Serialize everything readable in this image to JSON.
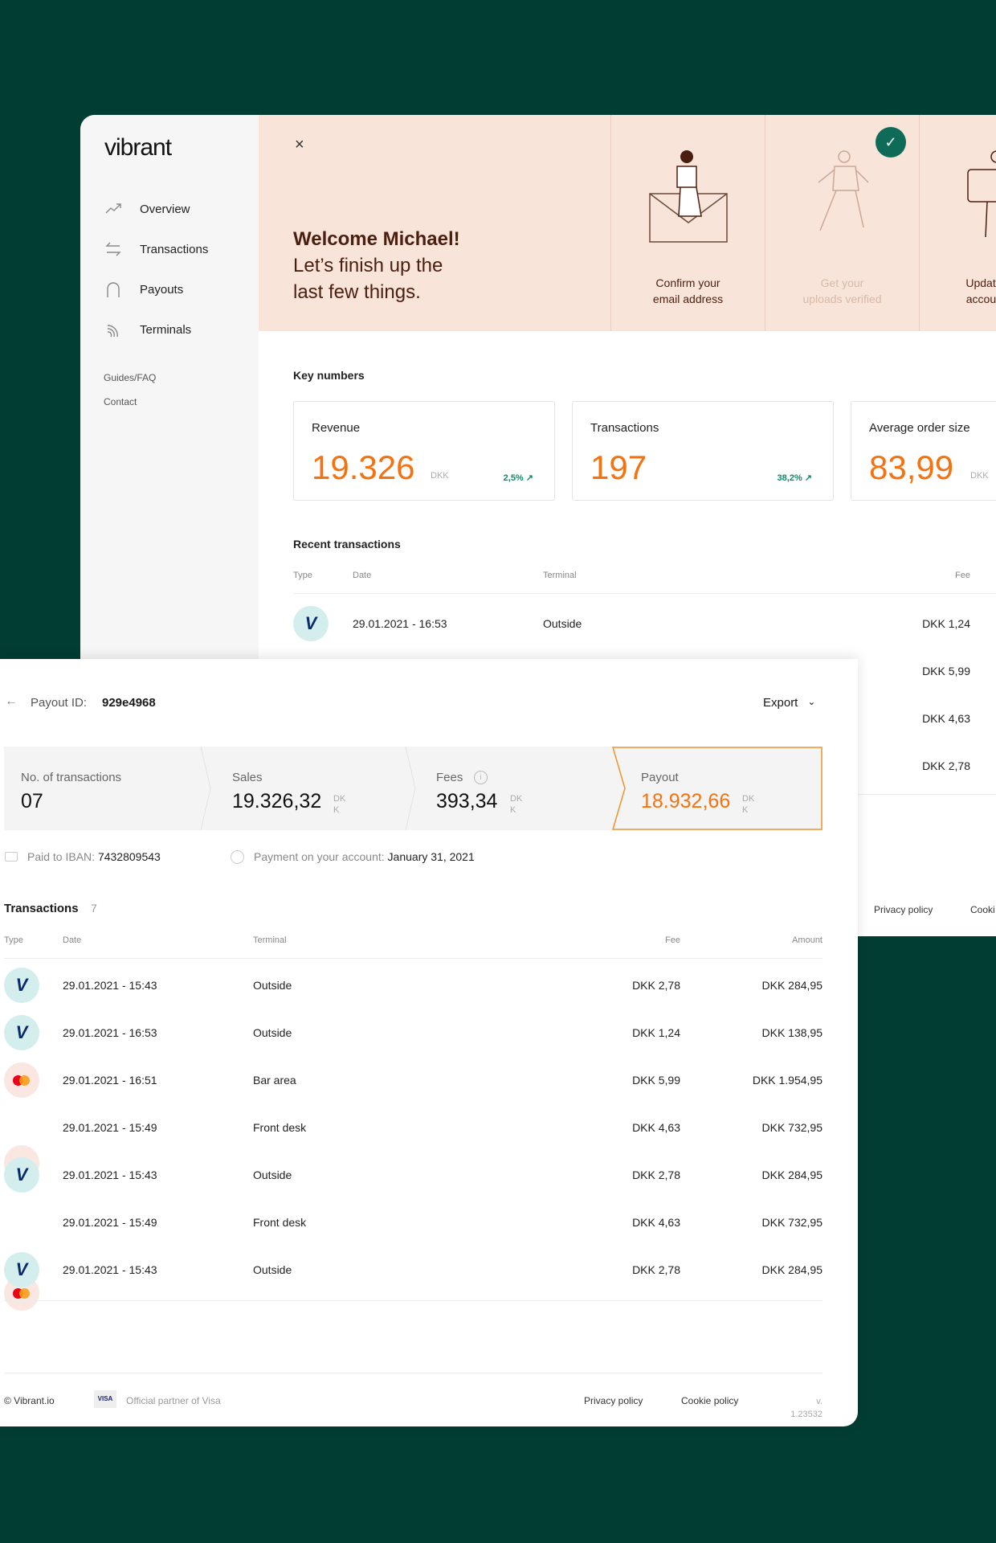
{
  "brand": {
    "logo": "vibrant"
  },
  "sidebar": {
    "items": [
      {
        "label": "Overview",
        "icon": "trend-up-icon"
      },
      {
        "label": "Transactions",
        "icon": "arrows-swap-icon"
      },
      {
        "label": "Payouts",
        "icon": "arch-icon"
      },
      {
        "label": "Terminals",
        "icon": "contactless-icon"
      }
    ],
    "links": [
      "Guides/FAQ",
      "Contact"
    ]
  },
  "banner": {
    "close": "×",
    "title": "Welcome Michael!",
    "subtitle_1": "Let’s finish up the",
    "subtitle_2": "last few things.",
    "steps": [
      {
        "line1": "Confirm your",
        "line2": "email address",
        "done": false
      },
      {
        "line1": "Get your",
        "line2": "uploads verified",
        "done": true
      },
      {
        "line1": "Update your",
        "line2": "account info",
        "done": false
      }
    ],
    "check": "✓"
  },
  "key_numbers": {
    "title": "Key numbers",
    "cards": [
      {
        "label": "Revenue",
        "value": "19.326",
        "unit": "DKK",
        "change": "2,5% ↗"
      },
      {
        "label": "Transactions",
        "value": "197",
        "change": "38,2% ↗"
      },
      {
        "label": "Average order size",
        "value": "83,99",
        "unit": "DKK"
      }
    ]
  },
  "recent": {
    "title": "Recent transactions",
    "headers": {
      "type": "Type",
      "date": "Date",
      "terminal": "Terminal",
      "fee": "Fee"
    },
    "rows": [
      {
        "type": "visa",
        "date": "29.01.2021 - 16:53",
        "terminal": "Outside",
        "fee": "DKK 1,24"
      },
      {
        "fee": "DKK 5,99"
      },
      {
        "fee": "DKK 4,63"
      },
      {
        "fee": "DKK 2,78"
      }
    ]
  },
  "back_footer": {
    "privacy": "Privacy policy",
    "cookie": "Cooki"
  },
  "payout": {
    "back": "←",
    "id_label": "Payout ID:",
    "id": "929e4968",
    "export": "Export",
    "chevron": "⌄",
    "stats": [
      {
        "label": "No. of transactions",
        "value": "07"
      },
      {
        "label": "Sales",
        "value": "19.326,32",
        "unit": "DKK"
      },
      {
        "label": "Fees",
        "value": "393,34",
        "unit": "DKK",
        "info": "i"
      },
      {
        "label": "Payout",
        "value": "18.932,66",
        "unit": "DKK"
      }
    ],
    "iban_label": "Paid to IBAN:",
    "iban": "7432809543",
    "payment_label": "Payment on your account:",
    "payment_date": "January 31, 2021",
    "tx_title": "Transactions",
    "tx_count": "7",
    "headers": {
      "type": "Type",
      "date": "Date",
      "terminal": "Terminal",
      "fee": "Fee",
      "amount": "Amount"
    },
    "rows": [
      {
        "type": "visa",
        "date": "29.01.2021 - 15:43",
        "terminal": "Outside",
        "fee": "DKK 2,78",
        "amount": "DKK 284,95"
      },
      {
        "type": "visa",
        "date": "29.01.2021 - 16:53",
        "terminal": "Outside",
        "fee": "DKK 1,24",
        "amount": "DKK 138,95"
      },
      {
        "type": "mastercard",
        "date": "29.01.2021 - 16:51",
        "terminal": "Bar area",
        "fee": "DKK 5,99",
        "amount": "DKK 1.954,95"
      },
      {
        "type": "mastercard",
        "date": "29.01.2021 - 15:49",
        "terminal": "Front desk",
        "fee": "DKK 4,63",
        "amount": "DKK 732,95"
      },
      {
        "type": "visa",
        "date": "29.01.2021 - 15:43",
        "terminal": "Outside",
        "fee": "DKK 2,78",
        "amount": "DKK 284,95"
      },
      {
        "type": "mastercard",
        "date": "29.01.2021 - 15:49",
        "terminal": "Front desk",
        "fee": "DKK 4,63",
        "amount": "DKK 732,95"
      },
      {
        "type": "visa",
        "date": "29.01.2021 - 15:43",
        "terminal": "Outside",
        "fee": "DKK 2,78",
        "amount": "DKK 284,95"
      }
    ]
  },
  "footer": {
    "copyright": "© Vibrant.io",
    "visa_badge": "VISA",
    "partner": "Official partner of Visa",
    "privacy": "Privacy policy",
    "cookie": "Cookie policy",
    "version_1": "v.",
    "version_2": "1.23532"
  },
  "colors": {
    "bg": "#023d33",
    "accent": "#f57210",
    "banner": "#f8e4d9",
    "positive": "#0e8a6a"
  }
}
